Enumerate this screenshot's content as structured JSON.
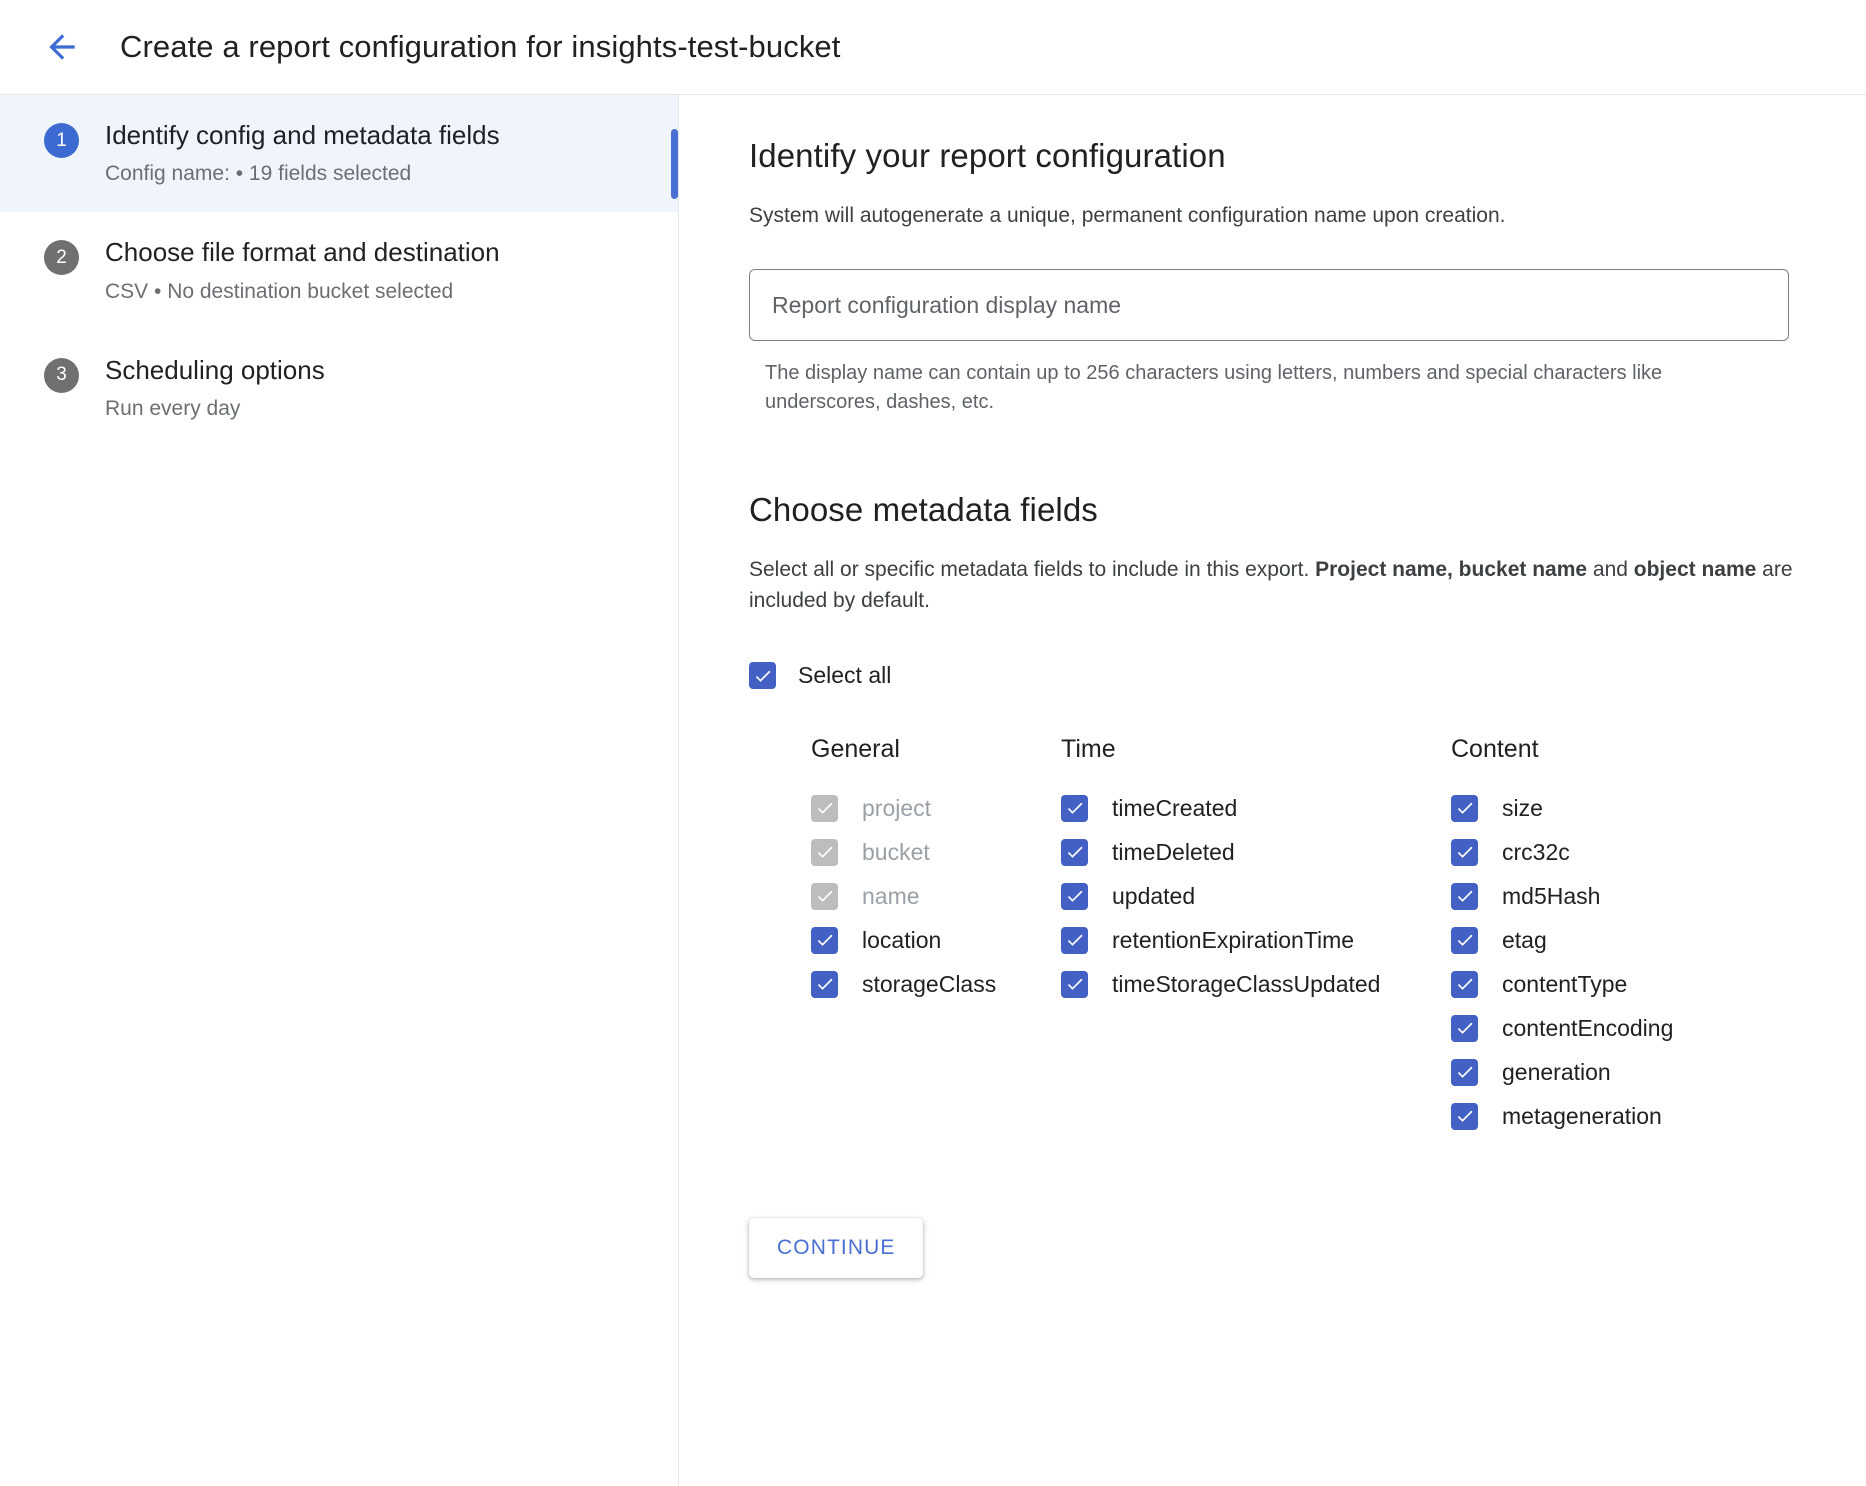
{
  "header": {
    "back_icon": "arrow-left-icon",
    "title": "Create a report configuration for insights-test-bucket"
  },
  "stepper": {
    "steps": [
      {
        "number": "1",
        "title": "Identify config and metadata fields",
        "subtitle": "Config name: • 19 fields selected",
        "active": true
      },
      {
        "number": "2",
        "title": "Choose file format and destination",
        "subtitle": "CSV • No destination bucket selected",
        "active": false
      },
      {
        "number": "3",
        "title": "Scheduling options",
        "subtitle": "Run every day",
        "active": false
      }
    ]
  },
  "main": {
    "identify": {
      "heading": "Identify your report configuration",
      "description": "System will autogenerate a unique, permanent configuration name upon creation.",
      "input_value": "",
      "input_placeholder": "Report configuration display name",
      "hint": "The display name can contain up to 256 characters using letters, numbers and special characters like underscores, dashes, etc."
    },
    "metadata": {
      "heading": "Choose metadata fields",
      "description_part1": "Select all or specific metadata fields to include in this export. ",
      "description_bold1": "Project name, bucket name",
      "description_part2": " and ",
      "description_bold2": "object name",
      "description_part3": " are included by default.",
      "select_all_label": "Select all",
      "select_all_checked": true,
      "columns": [
        {
          "header": "General",
          "fields": [
            {
              "label": "project",
              "checked": true,
              "disabled": true
            },
            {
              "label": "bucket",
              "checked": true,
              "disabled": true
            },
            {
              "label": "name",
              "checked": true,
              "disabled": true
            },
            {
              "label": "location",
              "checked": true,
              "disabled": false
            },
            {
              "label": "storageClass",
              "checked": true,
              "disabled": false
            }
          ]
        },
        {
          "header": "Time",
          "fields": [
            {
              "label": "timeCreated",
              "checked": true,
              "disabled": false
            },
            {
              "label": "timeDeleted",
              "checked": true,
              "disabled": false
            },
            {
              "label": "updated",
              "checked": true,
              "disabled": false
            },
            {
              "label": "retentionExpirationTime",
              "checked": true,
              "disabled": false
            },
            {
              "label": "timeStorageClassUpdated",
              "checked": true,
              "disabled": false
            }
          ]
        },
        {
          "header": "Content",
          "fields": [
            {
              "label": "size",
              "checked": true,
              "disabled": false
            },
            {
              "label": "crc32c",
              "checked": true,
              "disabled": false
            },
            {
              "label": "md5Hash",
              "checked": true,
              "disabled": false
            },
            {
              "label": "etag",
              "checked": true,
              "disabled": false
            },
            {
              "label": "contentType",
              "checked": true,
              "disabled": false
            },
            {
              "label": "contentEncoding",
              "checked": true,
              "disabled": false
            },
            {
              "label": "generation",
              "checked": true,
              "disabled": false
            },
            {
              "label": "metageneration",
              "checked": true,
              "disabled": false
            }
          ]
        }
      ]
    },
    "continue_label": "CONTINUE"
  },
  "colors": {
    "accent_blue": "#4360c4",
    "step_active_blue": "#3c6ad1",
    "step_inactive_gray": "#6f7072",
    "active_row_bg": "#f0f4fd",
    "disabled_checkbox": "#bdbdbd",
    "link_blue": "#4a6fd4"
  }
}
